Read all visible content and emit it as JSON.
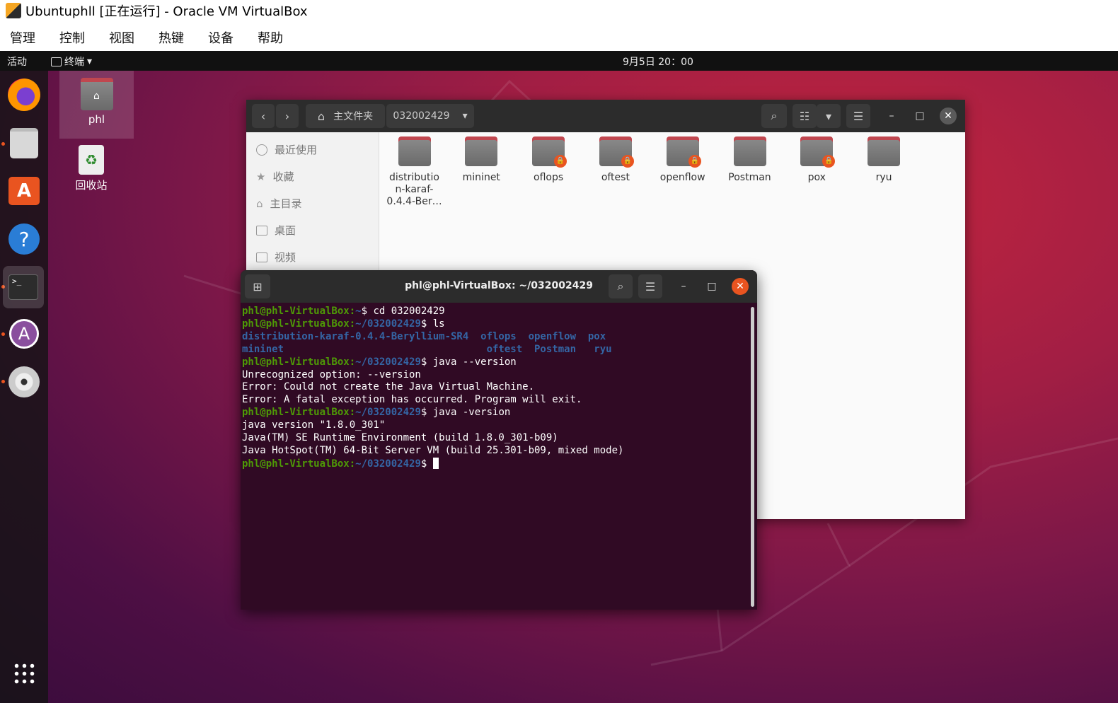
{
  "vbox": {
    "title": "Ubuntuphll [正在运行] - Oracle VM VirtualBox",
    "menu": [
      "管理",
      "控制",
      "视图",
      "热键",
      "设备",
      "帮助"
    ]
  },
  "gnome": {
    "activities": "活动",
    "app_menu": "终端",
    "clock": "9月5日 20：00"
  },
  "dock": {
    "items": [
      "firefox-icon",
      "files-icon",
      "software-icon",
      "help-icon",
      "terminal-icon",
      "snap-store-icon",
      "disc-icon"
    ],
    "show_apps": "grid-icon"
  },
  "desktop_icons": [
    {
      "label": "phl",
      "icon": "home-folder-icon"
    },
    {
      "label": "回收站",
      "icon": "trash-icon"
    }
  ],
  "nautilus": {
    "path_home": "主文件夹",
    "path_current": "032002429",
    "sidebar": [
      {
        "label": "最近使用",
        "icon": "clock-icon"
      },
      {
        "label": "收藏",
        "icon": "star-icon"
      },
      {
        "label": "主目录",
        "icon": "home-icon"
      },
      {
        "label": "桌面",
        "icon": "desktop-icon"
      },
      {
        "label": "视频",
        "icon": "video-icon"
      }
    ],
    "folders": [
      {
        "name": "distributio\nn-karaf-\n0.4.4-Ber…",
        "locked": false
      },
      {
        "name": "mininet",
        "locked": false
      },
      {
        "name": "oflops",
        "locked": true
      },
      {
        "name": "oftest",
        "locked": true
      },
      {
        "name": "openflow",
        "locked": true
      },
      {
        "name": "Postman",
        "locked": false
      },
      {
        "name": "pox",
        "locked": true
      },
      {
        "name": "ryu",
        "locked": false
      }
    ]
  },
  "terminal": {
    "title": "phl@phl-VirtualBox: ~/032002429",
    "prompt_user": "phl@phl-VirtualBox",
    "lines": [
      {
        "type": "cmd",
        "path": "~",
        "cmd": "cd 032002429"
      },
      {
        "type": "cmd",
        "path": "~/032002429",
        "cmd": "ls"
      },
      {
        "type": "ls",
        "text": "distribution-karaf-0.4.4-Beryllium-SR4  oflops  openflow  pox"
      },
      {
        "type": "ls",
        "text": "mininet                                  oftest  Postman   ryu"
      },
      {
        "type": "cmd",
        "path": "~/032002429",
        "cmd": "java --version"
      },
      {
        "type": "out",
        "text": "Unrecognized option: --version"
      },
      {
        "type": "out",
        "text": "Error: Could not create the Java Virtual Machine."
      },
      {
        "type": "out",
        "text": "Error: A fatal exception has occurred. Program will exit."
      },
      {
        "type": "cmd",
        "path": "~/032002429",
        "cmd": "java -version"
      },
      {
        "type": "out",
        "text": "java version \"1.8.0_301\""
      },
      {
        "type": "out",
        "text": "Java(TM) SE Runtime Environment (build 1.8.0_301-b09)"
      },
      {
        "type": "out",
        "text": "Java HotSpot(TM) 64-Bit Server VM (build 25.301-b09, mixed mode)"
      },
      {
        "type": "cmd",
        "path": "~/032002429",
        "cmd": "",
        "cursor": true
      }
    ]
  },
  "colors": {
    "accent": "#e95420",
    "terminal_bg": "#300a24",
    "prompt_user": "#4e9a06",
    "prompt_path": "#3465a4"
  }
}
